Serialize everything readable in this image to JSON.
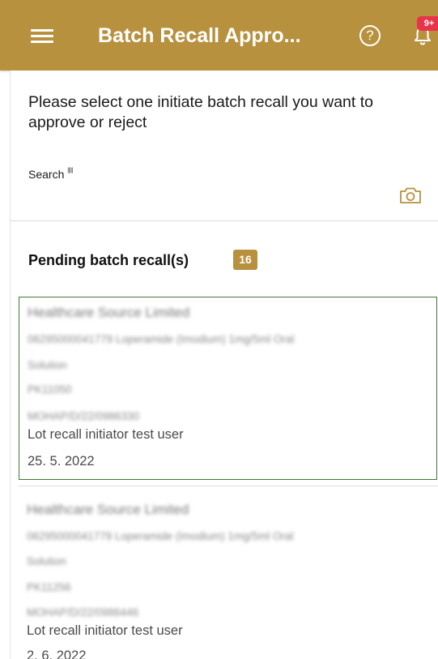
{
  "header": {
    "title": "Batch Recall Appro...",
    "help_icon": "?",
    "notification_count": "9+"
  },
  "instruction": "Please select one initiate batch recall you want to approve or reject",
  "search": {
    "label": "Search",
    "barcode_glyph": "|||||",
    "value": "",
    "placeholder": ""
  },
  "pending": {
    "title": "Pending batch recall(s)",
    "count": "16"
  },
  "recalls": [
    {
      "company": "Healthcare Source Limited",
      "product_line1": "06295000041779 Loperamide (Imodium) 1mg/5ml Oral",
      "product_line2": "Solution",
      "batch": "PK11050",
      "reference": "MOHAP/D/22/0986330",
      "initiator": "Lot recall initiator test user",
      "date": "25. 5. 2022",
      "selected": true
    },
    {
      "company": "Healthcare Source Limited",
      "product_line1": "06295000041779 Loperamide (Imodium) 1mg/5ml Oral",
      "product_line2": "Solution",
      "batch": "PK11256",
      "reference": "MOHAP/D/22/0986446",
      "initiator": "Lot recall initiator test user",
      "date": "2. 6. 2022",
      "selected": false
    }
  ],
  "colors": {
    "brand": "#b8913f",
    "selected_border": "#3f7a35",
    "notification_badge": "#e8344a"
  }
}
